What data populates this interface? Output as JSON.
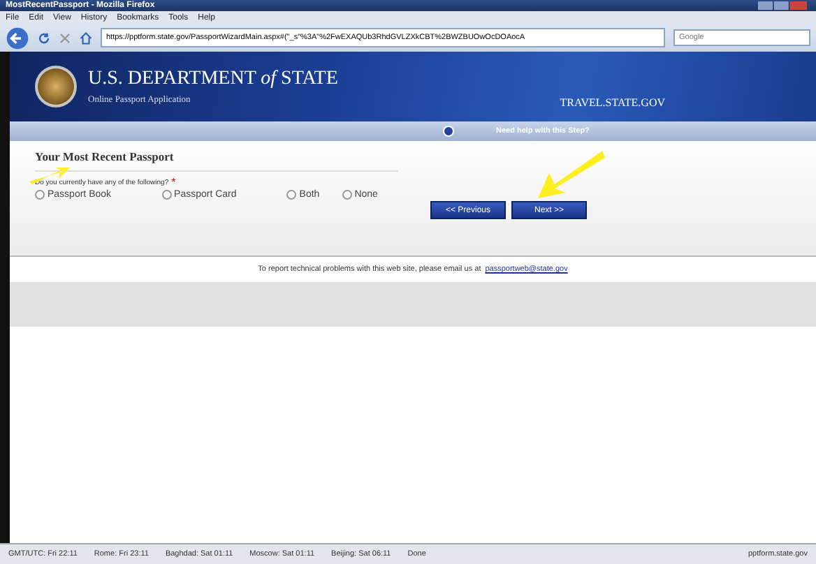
{
  "window": {
    "title": "MostRecentPassport - Mozilla Firefox"
  },
  "menu": [
    "File",
    "Edit",
    "View",
    "History",
    "Bookmarks",
    "Tools",
    "Help"
  ],
  "toolbar": {
    "url": "https://pptform.state.gov/PassportWizardMain.aspx#(\"_s\"%3A\"%2FwEXAQUb3RhdGVLZXkCBT%2BWZBUOwOcDOAocA",
    "search": {
      "placeholder": "Google"
    }
  },
  "header": {
    "title": "U.S. DEPARTMENT *of* STATE",
    "subtitle": "Online Passport Application",
    "site": "TRAVEL.STATE.GOV",
    "help": "Need help with this Step?"
  },
  "form": {
    "heading": "Your Most Recent Passport",
    "question": "Do you currently have any of the following?",
    "required": "*",
    "options": [
      {
        "label": "Passport Book",
        "selected": false
      },
      {
        "label": "Passport Card",
        "selected": false
      },
      {
        "label": "Both",
        "selected": false
      },
      {
        "label": "None",
        "selected": false
      }
    ],
    "buttons": [
      "<< Previous",
      "Next >>"
    ]
  },
  "footer": {
    "text": "To report technical problems with this web site, please email us at",
    "link": "passportweb@state.gov"
  },
  "status_bar": {
    "items": [
      "GMT/UTC: Fri 22:11",
      "Rome: Fri 23:11",
      "Baghdad: Sat 01:11",
      "Moscow: Sat 01:11",
      "Beijing: Sat 06:11",
      "Done"
    ],
    "host": "pptform.state.gov"
  }
}
